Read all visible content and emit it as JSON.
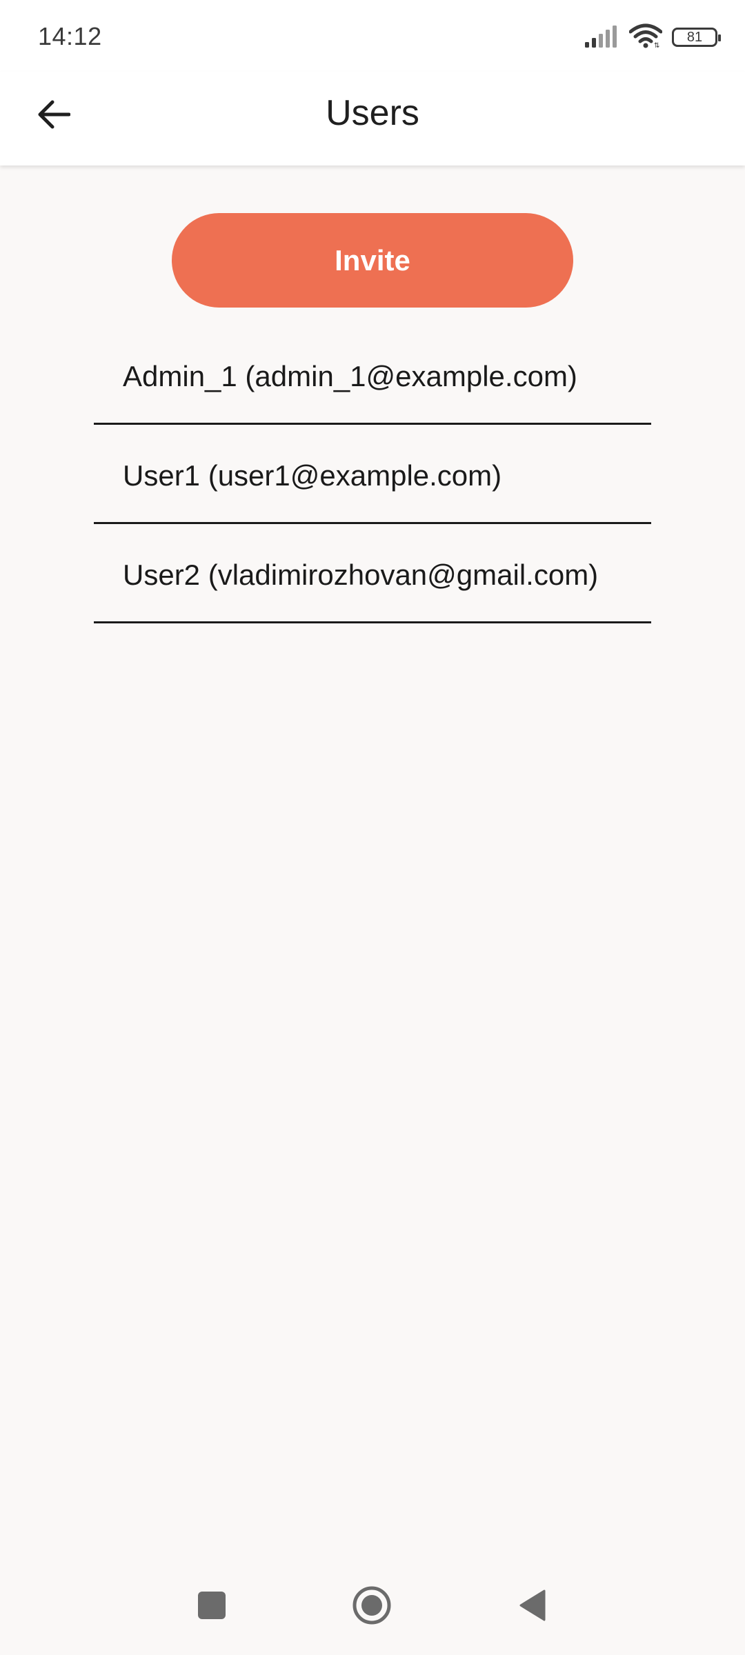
{
  "status_bar": {
    "time": "14:12",
    "battery": "81",
    "icons": [
      "signal-icon",
      "wifi-icon",
      "battery-icon"
    ]
  },
  "app_bar": {
    "title": "Users",
    "back_icon": "arrow-back-icon"
  },
  "actions": {
    "invite_label": "Invite"
  },
  "users": [
    {
      "label": "Admin_1 (admin_1@example.com)"
    },
    {
      "label": "User1 (user1@example.com)"
    },
    {
      "label": "User2 (vladimirozhovan@gmail.com)"
    }
  ],
  "nav_bar": {
    "icons": [
      "recents-square-icon",
      "home-circle-icon",
      "back-triangle-icon"
    ]
  },
  "colors": {
    "accent": "#ee7052",
    "background": "#faf8f7",
    "text": "#1a1a1a"
  }
}
